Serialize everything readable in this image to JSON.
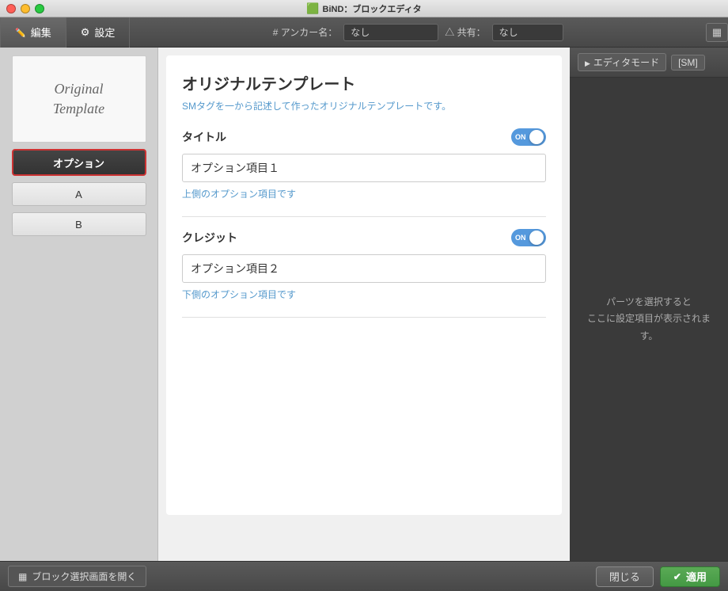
{
  "titleBar": {
    "title": "BiND：ブロックエディタ",
    "icon": "🟩"
  },
  "toolbar": {
    "edit_label": "編集",
    "settings_label": "設定",
    "anchor_label": "# アンカー名：",
    "anchor_value": "なし",
    "share_label": "△ 共有：",
    "share_value": "なし"
  },
  "rightToolbar": {
    "editor_mode_label": "エディタモード",
    "sm_label": "[SM]"
  },
  "sidebar": {
    "template_text_line1": "Original",
    "template_text_line2": "Template",
    "option_btn_label": "オプション",
    "tab_a_label": "A",
    "tab_b_label": "B"
  },
  "mainPanel": {
    "title": "オリジナルテンプレート",
    "description": "SMタグを一から記述して作ったオリジナルテンプレートです。",
    "section1": {
      "label": "タイトル",
      "toggle_on": true,
      "input_value": "オプション項目１",
      "hint": "上側のオプション項目です"
    },
    "section2": {
      "label": "クレジット",
      "toggle_on": true,
      "input_value": "オプション項目２",
      "hint": "下側のオプション項目です"
    }
  },
  "rightPanel": {
    "hint_line1": "パーツを選択すると",
    "hint_line2": "ここに設定項目が表示されます。"
  },
  "bottomBar": {
    "block_select_label": "ブロック選択画面を開く",
    "close_label": "閉じる",
    "apply_label": "適用"
  }
}
